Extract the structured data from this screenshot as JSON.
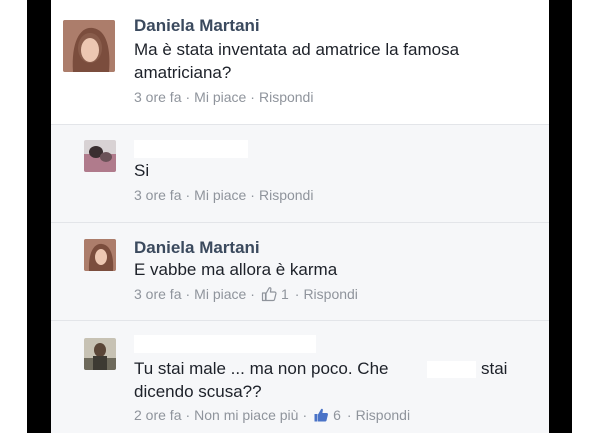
{
  "comments": [
    {
      "name": "Daniela Martani",
      "text_lines": [
        "Ma è stata inventata ad amatrice la famosa",
        "amatriciana?"
      ],
      "time": "3 ore fa",
      "like_link": "Mi piace",
      "reply": "Rispondi"
    },
    {
      "name": "",
      "text_lines": [
        "Si"
      ],
      "time": "3 ore fa",
      "like_link": "Mi piace",
      "reply": "Rispondi"
    },
    {
      "name": "Daniela Martani",
      "text_lines": [
        "E vabbe ma allora è karma"
      ],
      "time": "3 ore fa",
      "like_link": "Mi piace",
      "like_count": "1",
      "reply": "Rispondi"
    },
    {
      "name": "",
      "text_lines": [
        "Tu stai male ... ma non poco. Che",
        "stai",
        "dicendo scusa??"
      ],
      "time": "2 ore fa",
      "like_link": "Non mi piace più",
      "like_count": "6",
      "reply": "Rispondi"
    }
  ],
  "separator": "·",
  "colors": {
    "name": "#3b4a5e",
    "text": "#1d2129",
    "meta": "#8f949c",
    "like_icon_outline": "#8f949c",
    "like_icon_active": "#4a73c7",
    "panel": "#f6f7f9"
  },
  "icons": [
    "avatar",
    "thumbs-up-outline-icon",
    "thumbs-up-filled-icon"
  ]
}
